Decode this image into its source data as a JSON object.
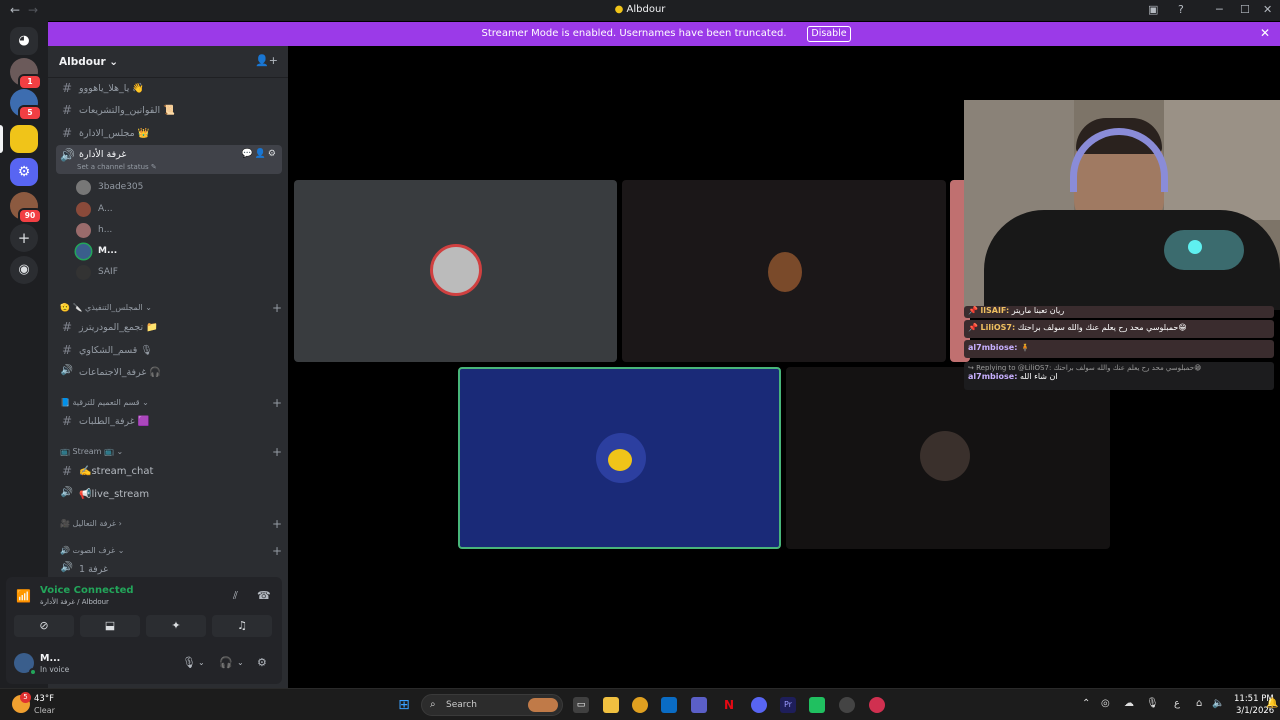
{
  "window": {
    "title": "Albdour",
    "back": "←",
    "forward": "→"
  },
  "banner": {
    "message": "Streamer Mode is enabled. Usernames have been truncated.",
    "action": "Disable",
    "close": "✕"
  },
  "servers": [
    {
      "name": "server-1",
      "badge": "1",
      "color": "#6b5a5a"
    },
    {
      "name": "server-2",
      "badge": "5",
      "color": "#3d6db0"
    },
    {
      "name": "server-3-active",
      "badge": "",
      "color": "#f0c419"
    },
    {
      "name": "server-4",
      "badge": "",
      "color": "#5865f2"
    },
    {
      "name": "server-5",
      "badge": "90",
      "color": "#8c5a40"
    }
  ],
  "guild": {
    "name": "Albdour",
    "chevron": "⌄"
  },
  "channels": [
    {
      "icon": "#",
      "label": "يا_هلا_ياهووو 👋",
      "type": "text"
    },
    {
      "icon": "#",
      "label": "القوانين_والتشريعات 📜",
      "type": "text"
    },
    {
      "icon": "#",
      "label": "مجلس_الادارة 👑",
      "type": "text"
    }
  ],
  "active_channel": {
    "label": "غرفة الأدارة",
    "status": "Set a channel status ✎"
  },
  "voice_users": [
    {
      "name": "3bade305",
      "color": "#777"
    },
    {
      "name": "A...",
      "color": "#8a4a3a"
    },
    {
      "name": "h...",
      "color": "#9a6b6b"
    },
    {
      "name": "M...",
      "color": "#3a5e8c"
    },
    {
      "name": "SAIF",
      "color": "#333"
    }
  ],
  "categories": [
    {
      "label": "🫡 🔪 المجلس_التنفيذي ⌄"
    },
    {
      "label": "📘 قسم التعميم للترقية ⌄"
    },
    {
      "label": "📺 Stream 📺 ⌄"
    },
    {
      "label": "🎥 غرفة التعاليل ›"
    },
    {
      "label": "🔊 غرف الصوت ⌄"
    }
  ],
  "cat1_channels": [
    {
      "icon": "#",
      "label": "تجمع_المودريترز 📁"
    },
    {
      "icon": "#",
      "label": "قسم_الشكاوي 🎙"
    },
    {
      "icon": "🔊",
      "label": "غرفة_الاجتماعات 🎧"
    }
  ],
  "cat2_channels": [
    {
      "icon": "#",
      "label": "غرفة_الطلبات 🟪"
    }
  ],
  "cat3_channels": [
    {
      "icon": "#",
      "label": "✍️stream_chat"
    },
    {
      "icon": "🔊",
      "label": "📢live_stream"
    }
  ],
  "cat5_channels": [
    {
      "icon": "🔊",
      "label": "غرفة 1"
    }
  ],
  "voice_panel": {
    "title": "Voice Connected",
    "subtitle": "غرفة الأدارة / Albdour"
  },
  "user_panel": {
    "name": "M...",
    "status": "In voice"
  },
  "chat_overlay": [
    {
      "user": "llSAIF:",
      "text": "ريان تعبنا ماريتر"
    },
    {
      "user": "LiliOS7:",
      "text": "حمبلوسي محد رح يعلم عنك والله سولف براحتك😁"
    },
    {
      "user": "al7mbiose:",
      "text": "🧍"
    },
    {
      "user": "Replying to @LiliOS7:",
      "text": "حمبلوسي محد رح يعلم عنك والله سولف براحتك😁"
    },
    {
      "user": "al7mbiose:",
      "text": "ان شاء الله"
    }
  ],
  "taskbar": {
    "weather_temp": "43°F",
    "weather_desc": "Clear",
    "weather_badge": "5",
    "search": "Search",
    "time": "11:51 PM",
    "date": "3/1/2026",
    "lang": "ع"
  },
  "colors": {
    "accent": "#5865f2",
    "banner": "#9b3ae8",
    "voice_green": "#23a55a"
  }
}
